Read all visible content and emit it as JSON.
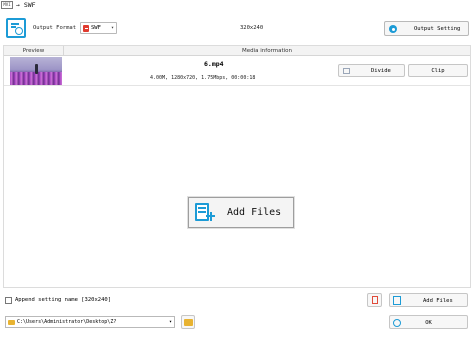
{
  "window": {
    "app_icon_text": "MVI",
    "title": "→ SWF"
  },
  "toolbar": {
    "brand_icon": "film-settings-icon",
    "format_label": "Output Format",
    "format_value": "SWF",
    "resolution": "320x240",
    "output_setting_label": "Output Setting"
  },
  "table": {
    "columns": [
      "Preview",
      "Media information"
    ],
    "rows": [
      {
        "name": "6.mp4",
        "meta": "4.00M, 1280x720, 1.75Mbps, 00:00:18",
        "divide_label": "Divide",
        "clip_label": "Clip"
      }
    ]
  },
  "center": {
    "add_files_label": "Add Files"
  },
  "bottom": {
    "append_label": "Append setting name [320x240]",
    "add_files_label": "Add Files",
    "output_path": "C:\\Users\\Administrator\\Desktop\\Z?",
    "ok_label": "OK"
  },
  "colors": {
    "accent": "#1c9bd6",
    "danger": "#e03b2f",
    "folder": "#e8b331"
  }
}
